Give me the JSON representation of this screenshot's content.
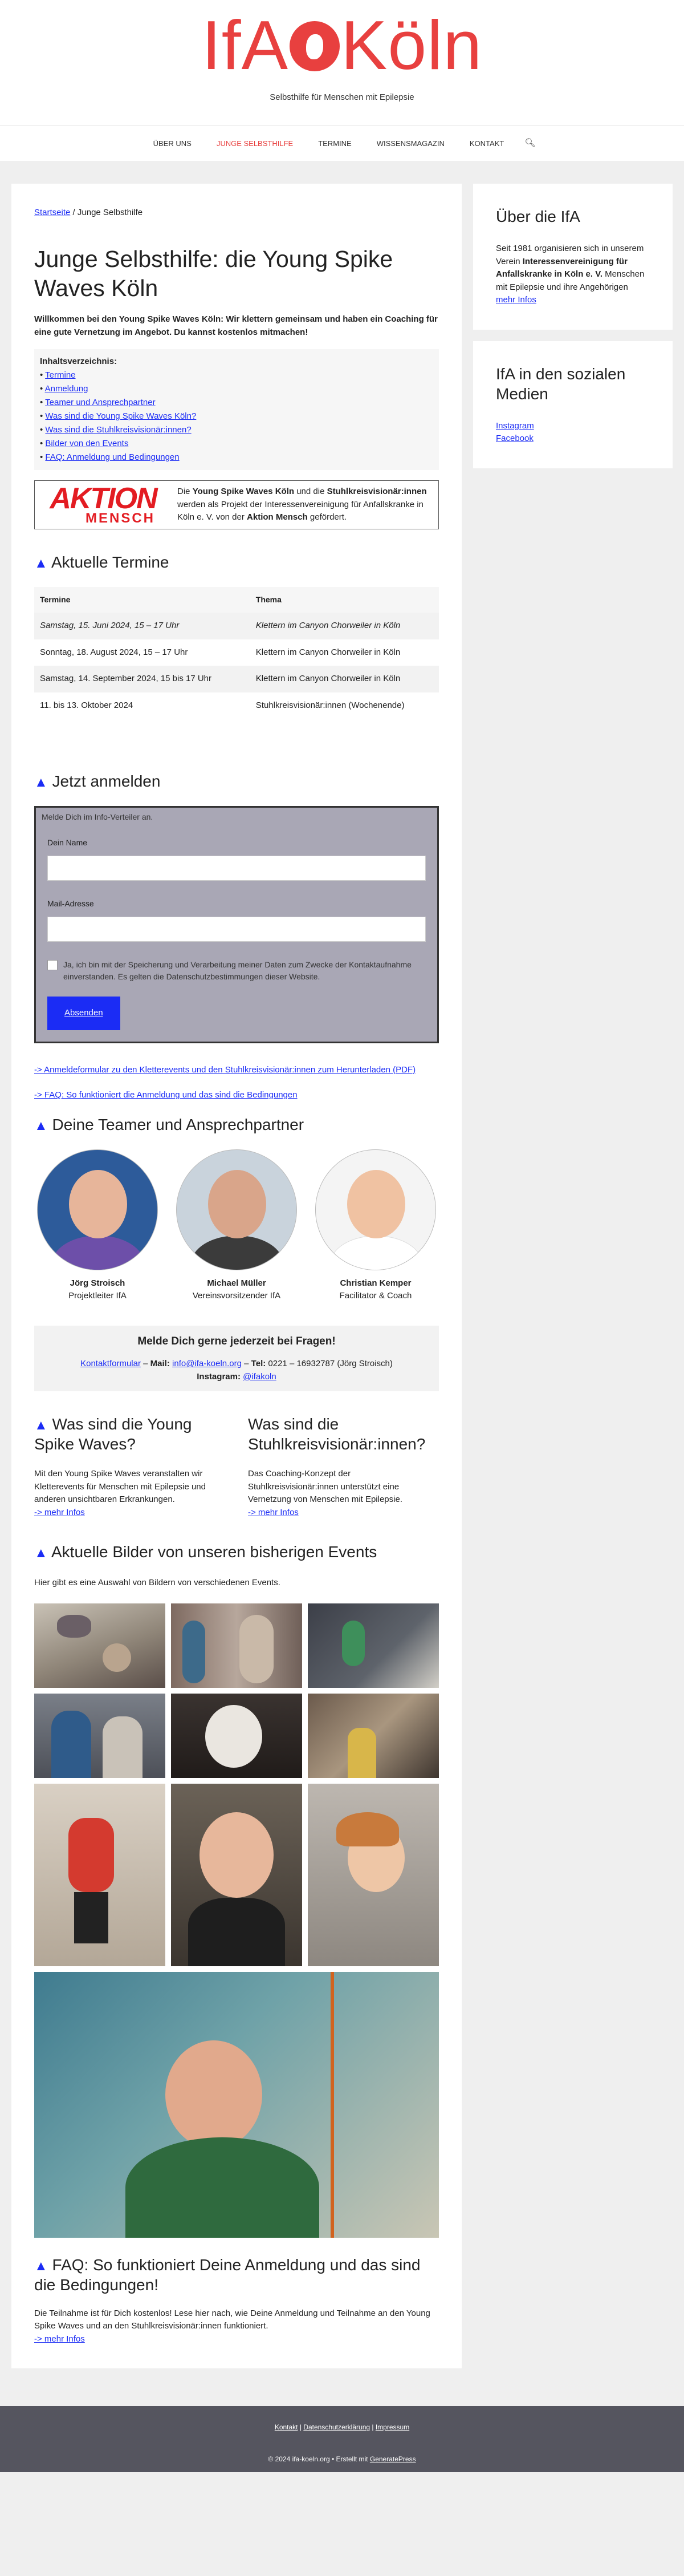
{
  "site": {
    "logo_text_a": "IfA",
    "logo_text_b": "Köln",
    "tagline": "Selbsthilfe für Menschen mit Epilepsie"
  },
  "nav": {
    "items": [
      "ÜBER UNS",
      "JUNGE SELBSTHILFE",
      "TERMINE",
      "WISSENSMAGAZIN",
      "KONTAKT"
    ],
    "active_color": "#e8403f",
    "search_icon": "search-icon"
  },
  "breadcrumb": {
    "home": "Startseite",
    "sep": " / ",
    "current": "Junge Selbsthilfe"
  },
  "page": {
    "title": "Junge Selbsthilfe: die Young Spike Waves Köln",
    "intro": "Willkommen bei den Young Spike Waves Köln: Wir klettern gemeinsam und haben ein Coaching für eine gute Vernetzung im Angebot. Du kannst kostenlos mitmachen!"
  },
  "toc": {
    "title": "Inhaltsverzeichnis",
    "items": [
      "Termine",
      "Anmeldung",
      "Teamer und Ansprechpartner",
      "Was sind die Young Spike Waves Köln?",
      "Was sind die Stuhlkreisvisionär:innen?",
      "Bilder von den Events",
      "FAQ: Anmeldung und Bedingungen"
    ]
  },
  "aktion": {
    "logo_big": "AKTION",
    "logo_small": "MENSCH",
    "t1": "Die ",
    "b1": "Young Spike Waves Köln",
    "t2": " und die ",
    "b2": "Stuhlkreisvisionär:innen",
    "t3": " werden als Projekt der Interessenvereinigung für Anfallskranke in Köln e. V. von der ",
    "b3": "Aktion Mensch",
    "t4": " gefördert."
  },
  "termine": {
    "heading": "Aktuelle Termine",
    "col1": "Termine",
    "col2": "Thema",
    "rows": [
      {
        "date": "Samstag, 15. Juni 2024, 15 – 17 Uhr",
        "topic": "Klettern im Canyon Chorweiler in Köln"
      },
      {
        "date": "Sonntag, 18. August 2024, 15 – 17 Uhr",
        "topic": "Klettern im Canyon Chorweiler in Köln"
      },
      {
        "date": "Samstag, 14. September 2024, 15 bis 17 Uhr",
        "topic": "Klettern im Canyon Chorweiler in Köln"
      },
      {
        "date": "11. bis 13. Oktober 2024",
        "topic": "Stuhlkreisvisionär:innen (Wochenende)"
      }
    ]
  },
  "anmelden": {
    "heading": "Jetzt anmelden",
    "hint": "Melde Dich im Info-Verteiler an.",
    "name_label": "Dein Name",
    "mail_label": "Mail-Adresse",
    "consent": "Ja, ich bin mit der Speicherung und Verarbeitung meiner Daten zum Zwecke der Kontaktaufnahme einverstanden. Es gelten die Datenschutzbestimmungen dieser Website.",
    "submit": "Absenden",
    "link1": "-> Anmeldeformular zu den Kletterevents und den Stuhlkreisvisionär:innen zum Herunterladen (PDF)",
    "link2": "-> FAQ: So funktioniert die Anmeldung und das sind die Bedingungen"
  },
  "team": {
    "heading": "Deine Teamer und Ansprechpartner",
    "members": [
      {
        "name": "Jörg Stroisch",
        "role": "Projektleiter IfA"
      },
      {
        "name": "Michael Müller",
        "role": "Vereinsvorsitzender IfA"
      },
      {
        "name": "Christian Kemper",
        "role": "Facilitator & Coach"
      }
    ]
  },
  "contact": {
    "heading": "Melde Dich gerne jederzeit bei Fragen!",
    "form_link": "Kontaktformular",
    "sep1": " – ",
    "mail_label": "Mail:",
    "mail": "info@ifa-koeln.org",
    "sep2": " – ",
    "tel_label": "Tel:",
    "tel": "0221 – 16932787 (Jörg Stroisch)",
    "insta_label": "Instagram:",
    "insta": "@ifakoln"
  },
  "ysw": {
    "heading": "Was sind die Young Spike Waves?",
    "text": "Mit den Young Spike Waves veranstalten wir Kletterevents für Menschen mit Epilepsie und anderen unsichtbaren Erkrankungen.",
    "more": "-> mehr Infos"
  },
  "skv": {
    "heading": "Was sind die Stuhlkreisvisionär:innen?",
    "text": "Das Coaching-Konzept der Stuhlkreisvisionär:innen unterstützt eine Vernetzung von Menschen mit Epilepsie.",
    "more": "-> mehr Infos"
  },
  "gallery": {
    "heading": "Aktuelle Bilder von unseren bisherigen Events",
    "intro": "Hier gibt es eine Auswahl von Bildern von verschiedenen Events."
  },
  "faq": {
    "heading": "FAQ: So funktioniert Deine Anmeldung und das sind die Bedingungen!",
    "text": "Die Teilnahme ist für Dich kostenlos! Lese hier nach, wie Deine Anmeldung und Teilnahme an den Young Spike Waves und an den Stuhlkreisvisionär:innen funktioniert.",
    "more": "-> mehr Infos"
  },
  "sidebar": {
    "about_title": "Über die IfA",
    "about_t1": "Seit 1981 organisieren sich in unserem Verein ",
    "about_b": "Interessenvereinigung für Anfallskranke in Köln e. V.",
    "about_t2": " Menschen mit Epilepsie und ihre Angehörigen",
    "about_more": "mehr Infos",
    "social_title": "IfA in den sozialen Medien",
    "social_links": [
      "Instagram",
      "Facebook"
    ]
  },
  "footer": {
    "links": [
      "Kontakt",
      "Datenschutzerklärung",
      "Impressum"
    ],
    "pipe": " | ",
    "copy": "© 2024 ifa-koeln.org • Erstellt mit ",
    "gp": "GeneratePress"
  }
}
